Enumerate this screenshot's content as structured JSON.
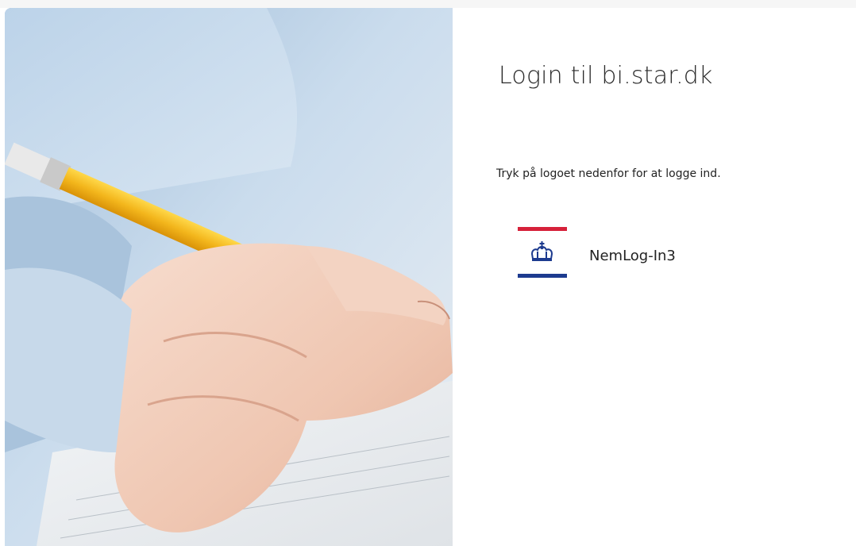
{
  "page": {
    "title": "Login til bi.star.dk",
    "instruction": "Tryk på logoet nedenfor for at logge ind."
  },
  "providers": [
    {
      "label": "NemLog-In3",
      "icon": "danish-crown-icon",
      "colors": {
        "top_bar": "#d6213a",
        "bottom_bar": "#1d3b8f",
        "crown": "#1d3b8f"
      }
    }
  ],
  "hero_image": {
    "icon": "pencil-writing-hand-photo"
  }
}
